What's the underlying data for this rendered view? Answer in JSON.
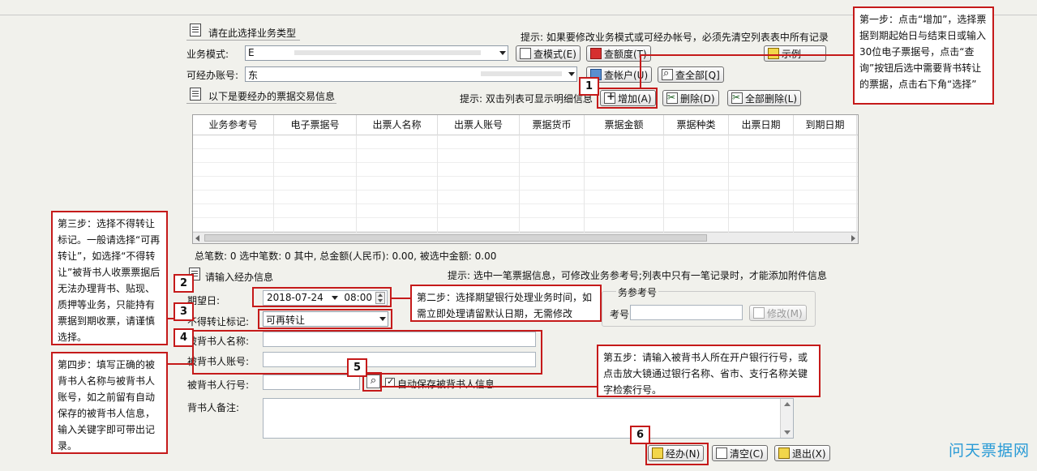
{
  "section_type": {
    "title": "请在此选择业务类型",
    "hint": "提示: 如果要修改业务模式或可经办帐号，必须先清空列表表中所有记录"
  },
  "biz_mode": {
    "label": "业务模式:",
    "value": "E"
  },
  "account": {
    "label": "可经办账号:",
    "value": "东"
  },
  "buttons": {
    "query_mode": "查模式(E)",
    "query_limit": "查额度(T)",
    "example": "示例",
    "query_account": "查帐户(U)",
    "query_all": "查全部[Q]",
    "add": "增加(A)",
    "delete": "删除(D)",
    "delete_all": "全部删除(L)",
    "modify": "修改(M)",
    "handle": "经办(N)",
    "clear": "清空(C)",
    "exit": "退出(X)"
  },
  "section_bills": {
    "title": "以下是要经办的票据交易信息",
    "hint": "提示: 双击列表可显示明细信息"
  },
  "table": {
    "columns": [
      "业务参考号",
      "电子票据号",
      "出票人名称",
      "出票人账号",
      "票据货币",
      "票据金额",
      "票据种类",
      "出票日期",
      "到期日期"
    ]
  },
  "summary": "总笔数: 0   选中笔数: 0   其中, 总金额(人民币): 0.00, 被选中金额: 0.00",
  "section_input": {
    "title": "请输入经办信息",
    "hint": "提示: 选中一笔票据信息，可修改业务参考号;列表中只有一笔记录时，才能添加附件信息"
  },
  "form": {
    "expected_date_label": "期望日:",
    "expected_date": "2018-07-24",
    "expected_time": "08:00",
    "transfer_label": "不得转让标记:",
    "transfer_value": "可再转让",
    "endorsee_name_label": "被背书人名称:",
    "endorsee_account_label": "被背书人账号:",
    "endorsee_bank_label": "被背书人行号:",
    "auto_save_label": "自动保存被背书人信息",
    "remark_label": "背书人备注:",
    "ref_group_label": "务参考号",
    "ref_label": "考号:"
  },
  "callouts": {
    "step1": "第一步：点击“增加”，选择票据到期起始日与结束日或输入30位电子票据号，点击“查询”按钮后选中需要背书转让的票据，点击右下角“选择”",
    "step2": "第二步：选择期望银行处理业务时间，如需立即处理请留默认日期，无需修改",
    "step3": "第三步：选择不得转让标记。一般请选择“可再转让”，如选择“不得转让”被背书人收票票据后无法办理背书、贴现、质押等业务，只能持有票据到期收票，请谨慎选择。",
    "step4": "第四步：填写正确的被背书人名称与被背书人账号，如之前留有自动保存的被背书人信息，输入关键字即可带出记录。",
    "step5": "第五步：请输入被背书人所在开户银行行号，或点击放大镜通过银行名称、省市、支行名称关键字检索行号。"
  },
  "markers": [
    "1",
    "2",
    "3",
    "4",
    "5",
    "6"
  ],
  "watermark": "问天票据网",
  "colors": {
    "annotation": "#c51a1a",
    "watermark": "#2a9bd6",
    "window_bg": "#f1f1ec"
  }
}
